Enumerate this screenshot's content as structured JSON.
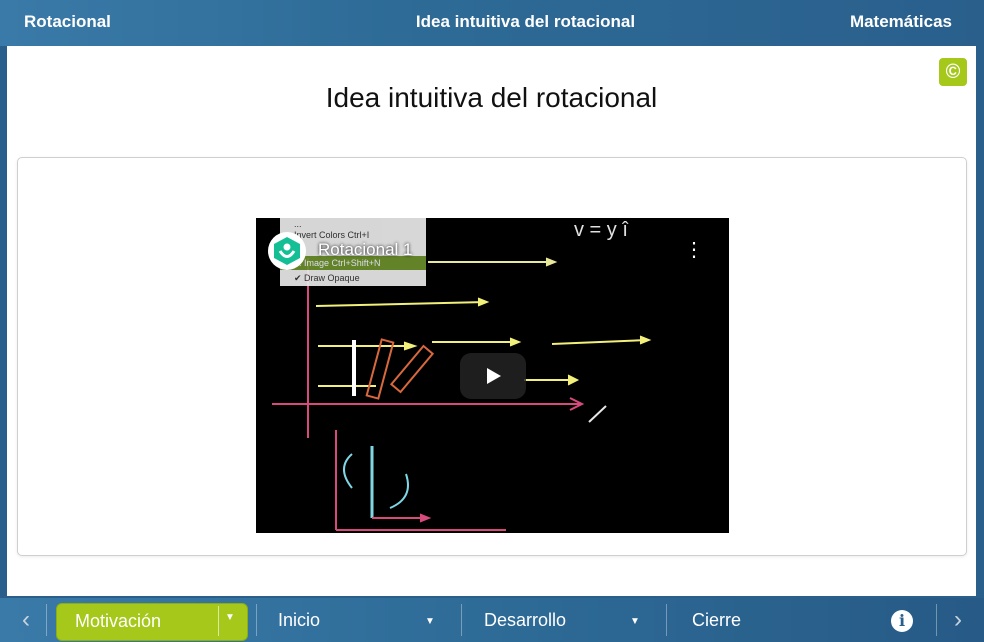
{
  "header": {
    "left": "Rotacional",
    "center": "Idea intuitiva del rotacional",
    "right": "Matemáticas"
  },
  "main": {
    "title": "Idea intuitiva del rotacional",
    "copyright_icon": "©"
  },
  "video": {
    "title": "Rotacional 1",
    "channel_icon": "khan-academy-logo",
    "menu_snippet": [
      "...",
      "Invert Colors   Ctrl+I",
      "... Image   Ctrl+Shift+N",
      "✔ Draw Opaque"
    ]
  },
  "bottom_nav": {
    "prev_icon": "‹",
    "next_icon": "›",
    "items": [
      {
        "label": "Motivación",
        "active": true
      },
      {
        "label": "Inicio"
      },
      {
        "label": "Desarrollo"
      },
      {
        "label": "Cierre"
      }
    ],
    "info_icon": "i"
  },
  "colors": {
    "header_bg": "#2a5f8c",
    "accent_green": "#a5c81a"
  }
}
